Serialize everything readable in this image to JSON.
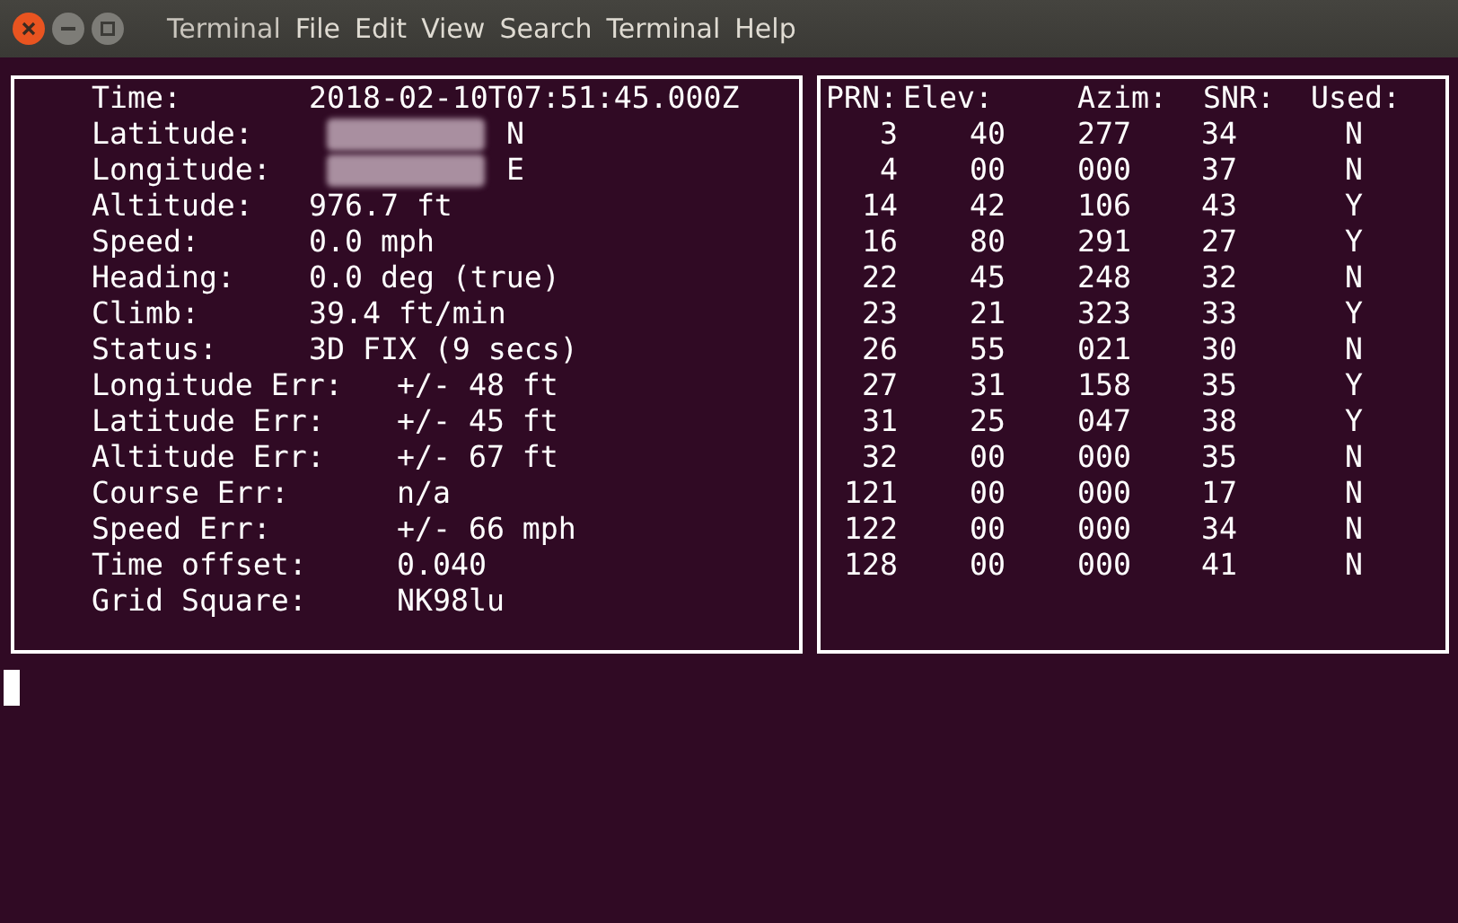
{
  "window": {
    "app_name": "Terminal",
    "menu": [
      "File",
      "Edit",
      "View",
      "Search",
      "Terminal",
      "Help"
    ]
  },
  "fix_panel": {
    "rows": [
      {
        "label": "Time:",
        "value": "2018-02-10T07:51:45.000Z",
        "kind": "basic",
        "redacted": false
      },
      {
        "label": "Latitude:",
        "value": "N",
        "kind": "basic",
        "redacted": true
      },
      {
        "label": "Longitude:",
        "value": "E",
        "kind": "basic",
        "redacted": true
      },
      {
        "label": "Altitude:",
        "value": "976.7 ft",
        "kind": "basic",
        "redacted": false
      },
      {
        "label": "Speed:",
        "value": "0.0 mph",
        "kind": "basic",
        "redacted": false
      },
      {
        "label": "Heading:",
        "value": "0.0 deg (true)",
        "kind": "basic",
        "redacted": false
      },
      {
        "label": "Climb:",
        "value": "39.4 ft/min",
        "kind": "basic",
        "redacted": false
      },
      {
        "label": "Status:",
        "value": "3D FIX (9 secs)",
        "kind": "basic",
        "redacted": false
      },
      {
        "label": "Longitude Err:",
        "value": "+/- 48 ft",
        "kind": "error",
        "redacted": false
      },
      {
        "label": "Latitude Err:",
        "value": "+/- 45 ft",
        "kind": "error",
        "redacted": false
      },
      {
        "label": "Altitude Err:",
        "value": "+/- 67 ft",
        "kind": "error",
        "redacted": false
      },
      {
        "label": "Course Err:",
        "value": "n/a",
        "kind": "error",
        "redacted": false
      },
      {
        "label": "Speed Err:",
        "value": "+/- 66 mph",
        "kind": "error",
        "redacted": false
      },
      {
        "label": "Time offset:",
        "value": "0.040",
        "kind": "error",
        "redacted": false
      },
      {
        "label": "Grid Square:",
        "value": "NK98lu",
        "kind": "error",
        "redacted": false
      }
    ]
  },
  "satellite_table": {
    "columns": [
      "PRN:",
      "Elev:",
      "Azim:",
      "SNR:",
      "Used:"
    ],
    "rows": [
      [
        "3",
        "40",
        "277",
        "34",
        "N"
      ],
      [
        "4",
        "00",
        "000",
        "37",
        "N"
      ],
      [
        "14",
        "42",
        "106",
        "43",
        "Y"
      ],
      [
        "16",
        "80",
        "291",
        "27",
        "Y"
      ],
      [
        "22",
        "45",
        "248",
        "32",
        "N"
      ],
      [
        "23",
        "21",
        "323",
        "33",
        "Y"
      ],
      [
        "26",
        "55",
        "021",
        "30",
        "N"
      ],
      [
        "27",
        "31",
        "158",
        "35",
        "Y"
      ],
      [
        "31",
        "25",
        "047",
        "38",
        "Y"
      ],
      [
        "32",
        "00",
        "000",
        "35",
        "N"
      ],
      [
        "121",
        "00",
        "000",
        "17",
        "N"
      ],
      [
        "122",
        "00",
        "000",
        "34",
        "N"
      ],
      [
        "128",
        "00",
        "000",
        "41",
        "N"
      ]
    ]
  }
}
